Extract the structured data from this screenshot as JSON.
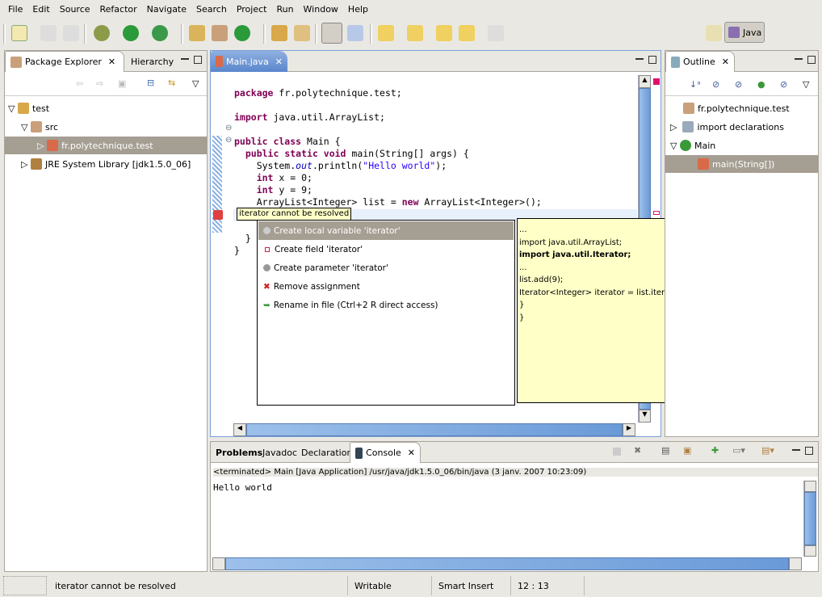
{
  "menu": [
    "File",
    "Edit",
    "Source",
    "Refactor",
    "Navigate",
    "Search",
    "Project",
    "Run",
    "Window",
    "Help"
  ],
  "perspective": {
    "label": "Java"
  },
  "package_explorer": {
    "tabs": [
      "Package Explorer",
      "Hierarchy"
    ],
    "tree": [
      {
        "label": "test"
      },
      {
        "label": "src"
      },
      {
        "label": "fr.polytechnique.test"
      },
      {
        "label": "JRE System Library [jdk1.5.0_06]"
      }
    ]
  },
  "editor": {
    "tab": "Main.java",
    "lines": [
      "package fr.polytechnique.test;",
      "",
      "import java.util.ArrayList;",
      "",
      "public class Main {",
      "  public static void main(String[] args) {",
      "    System.out.println(\"Hello world\");",
      "    int x = 0;",
      "    int y = 9;",
      "    ArrayList<Integer> list = new ArrayList<Integer>();",
      "    list.add(9);",
      "                  .iterator();",
      "  }",
      "}"
    ],
    "error_tooltip": "iterator cannot be resolved",
    "quickfix": [
      "Create local variable 'iterator'",
      "Create field 'iterator'",
      "Create parameter 'iterator'",
      "Remove assignment",
      "Rename in file (Ctrl+2 R direct access)"
    ],
    "preview": [
      "...",
      "import java.util.ArrayList;",
      "import java.util.Iterator;",
      "...",
      "list.add(9);",
      "Iterator<Integer> iterator = list.iterator();",
      "}",
      "}"
    ]
  },
  "outline": {
    "tab": "Outline",
    "items": [
      "fr.polytechnique.test",
      "import declarations",
      "Main",
      "main(String[])"
    ]
  },
  "bottom": {
    "tabs": [
      "Problems",
      "Javadoc",
      "Declaration",
      "Console"
    ],
    "terminated": "<terminated> Main [Java Application] /usr/java/jdk1.5.0_06/bin/java (3 janv. 2007 10:23:09)",
    "output": "Hello world"
  },
  "status": {
    "message": "iterator cannot be resolved",
    "writable": "Writable",
    "insert": "Smart Insert",
    "position": "12 : 13"
  }
}
